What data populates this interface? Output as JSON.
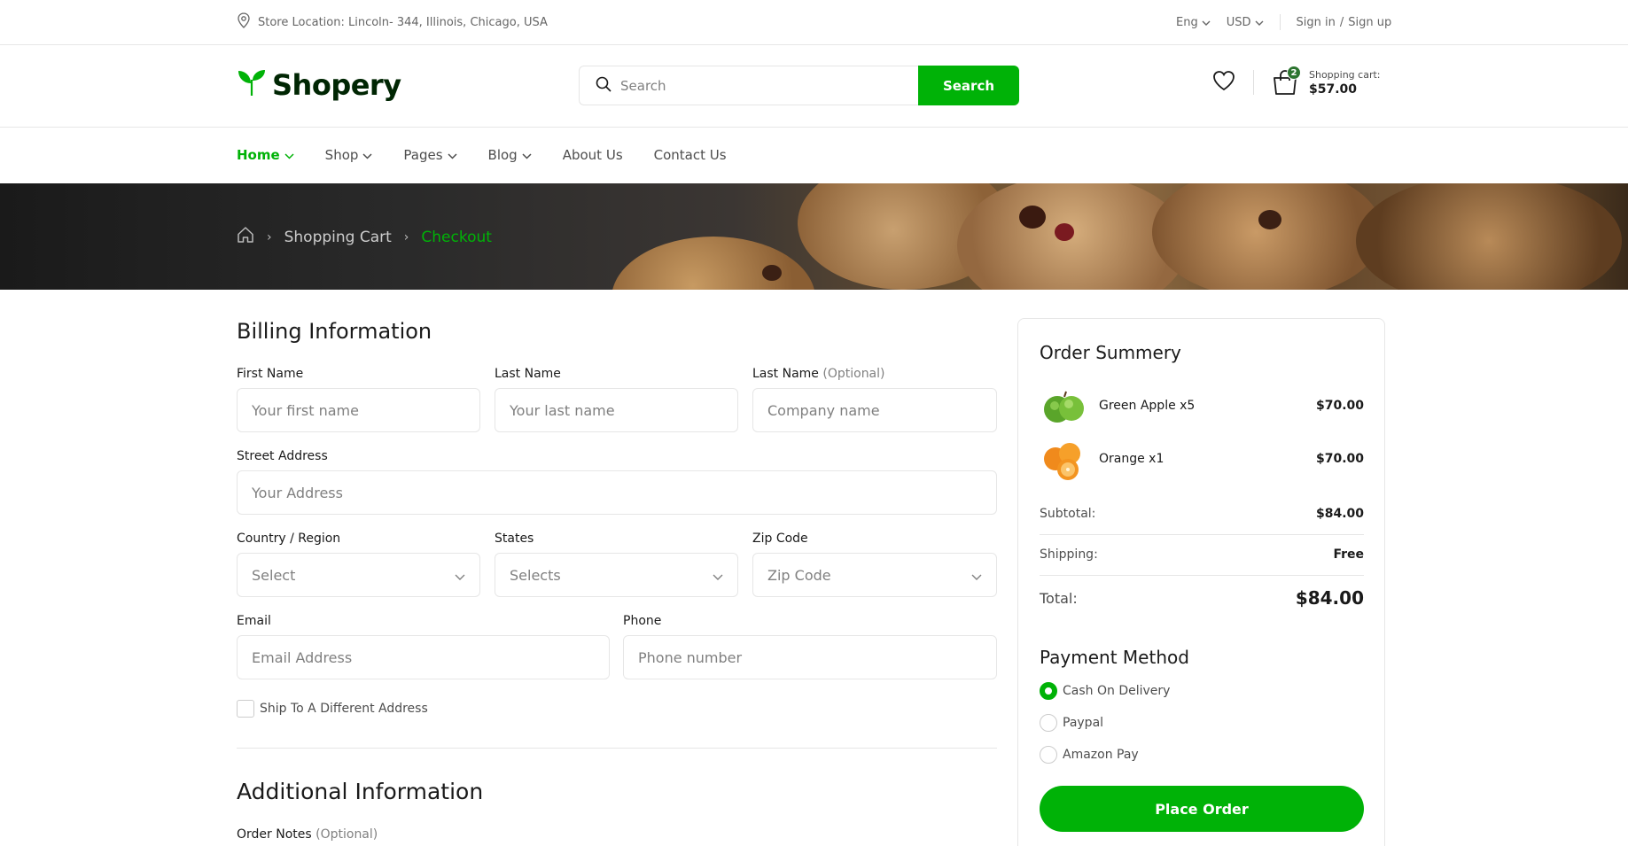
{
  "topbar": {
    "location": "Store Location: Lincoln- 344, Illinois, Chicago, USA",
    "language": "Eng",
    "currency": "USD",
    "sign_in": "Sign in",
    "slash": "/",
    "sign_up": "Sign up"
  },
  "header": {
    "logo_text": "Shopery",
    "search_placeholder": "Search",
    "search_button": "Search",
    "cart_count": "2",
    "cart_label": "Shopping cart:",
    "cart_amount": "$57.00"
  },
  "nav": {
    "items": [
      {
        "label": "Home"
      },
      {
        "label": "Shop"
      },
      {
        "label": "Pages"
      },
      {
        "label": "Blog"
      },
      {
        "label": "About Us"
      },
      {
        "label": "Contact Us"
      }
    ]
  },
  "breadcrumb": {
    "items": [
      "Shopping Cart",
      "Checkout"
    ]
  },
  "billing": {
    "title": "Billing Information",
    "first_name_label": "First Name",
    "first_name_placeholder": "Your first name",
    "last_name_label": "Last Name",
    "last_name_placeholder": "Your last name",
    "company_label": "Last Name",
    "company_optional": "(Optional)",
    "company_placeholder": "Company name",
    "street_label": "Street Address",
    "street_placeholder": "Your Address",
    "country_label": "Country / Region",
    "country_value": "Select",
    "states_label": "States",
    "states_value": "Selects",
    "zip_label": "Zip Code",
    "zip_value": "Zip Code",
    "email_label": "Email",
    "email_placeholder": "Email Address",
    "phone_label": "Phone",
    "phone_placeholder": "Phone number",
    "ship_different": "Ship To A Different Address"
  },
  "additional": {
    "title": "Additional Information",
    "notes_label": "Order Notes",
    "notes_optional": "(Optional)"
  },
  "summary": {
    "title": "Order Summery",
    "items": [
      {
        "name": "Green Apple x5",
        "price": "$70.00"
      },
      {
        "name": "Orange x1",
        "price": "$70.00"
      }
    ],
    "subtotal_label": "Subtotal:",
    "subtotal_value": "$84.00",
    "shipping_label": "Shipping:",
    "shipping_value": "Free",
    "total_label": "Total:",
    "total_value": "$84.00"
  },
  "payment": {
    "title": "Payment Method",
    "options": [
      {
        "label": "Cash On Delivery",
        "selected": true
      },
      {
        "label": "Paypal",
        "selected": false
      },
      {
        "label": "Amazon Pay",
        "selected": false
      }
    ],
    "place_order": "Place Order"
  },
  "colors": {
    "primary": "#00b207",
    "dark_green": "#2c742f",
    "border": "#e6e6e6",
    "text": "#1a1a1a"
  }
}
